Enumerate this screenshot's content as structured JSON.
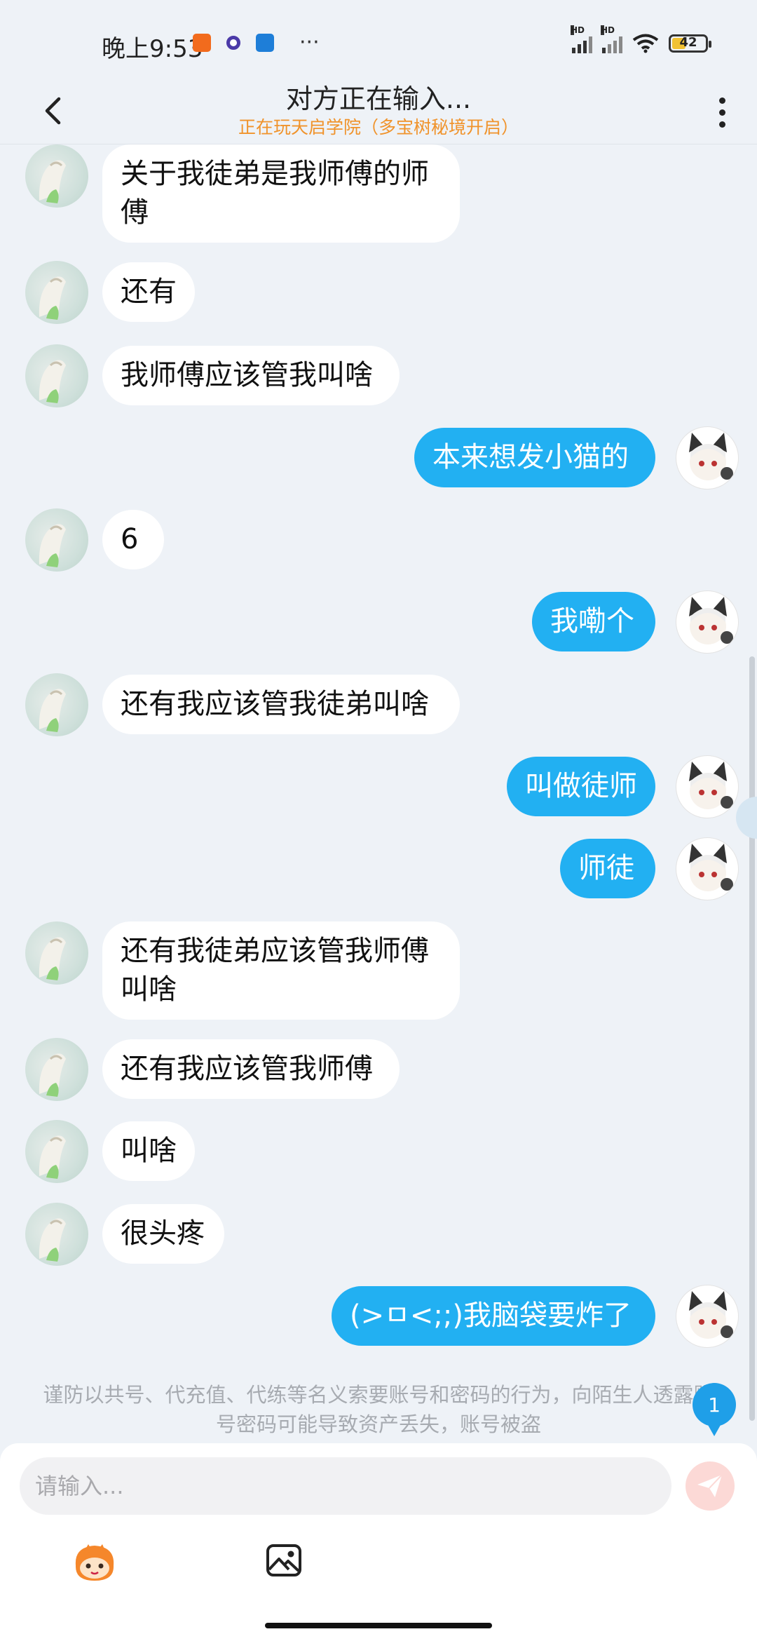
{
  "status_bar": {
    "time": "晚上9:53",
    "signal_label_1": "HD",
    "signal_label_2": "HD",
    "battery": "42",
    "battery_fraction": 0.42,
    "overflow": "···"
  },
  "header": {
    "title": "对方正在输入...",
    "subtitle": "正在玩天启学院（多宝树秘境开启）",
    "back_icon": "chevron-left-icon",
    "more_icon": "more-vertical-icon"
  },
  "colors": {
    "outgoing_bubble": "#22b0f2",
    "incoming_bubble": "#ffffff",
    "subtitle": "#f0932b",
    "badge": "#1f9fe8",
    "background": "#eef2f7"
  },
  "messages": [
    {
      "side": "left",
      "text": "关于我徒弟是我师傅的师\n傅"
    },
    {
      "side": "left",
      "text": "还有"
    },
    {
      "side": "left",
      "text": "我师傅应该管我叫啥"
    },
    {
      "side": "right",
      "text": "本来想发小猫的"
    },
    {
      "side": "left",
      "text": "6"
    },
    {
      "side": "right",
      "text": "我嘞个"
    },
    {
      "side": "left",
      "text": "还有我应该管我徒弟叫啥"
    },
    {
      "side": "right",
      "text": "叫做徒师"
    },
    {
      "side": "right",
      "text": "师徒"
    },
    {
      "side": "left",
      "text": "还有我徒弟应该管我师傅\n叫啥"
    },
    {
      "side": "left",
      "text": "还有我应该管我师傅"
    },
    {
      "side": "left",
      "text": "叫啥"
    },
    {
      "side": "left",
      "text": "很头疼"
    },
    {
      "side": "right",
      "text": "(>ㅁ<;;)我脑袋要炸了"
    }
  ],
  "notice": "谨防以共号、代充值、代练等名义索要账号和密码的行为，向陌生人透露账号密码可能导致资产丢失，账号被盗",
  "unread_badge": "1",
  "composer": {
    "placeholder": "请输入...",
    "send_icon": "send-icon",
    "emoji_icon": "emoji-face-icon",
    "image_icon": "image-icon"
  }
}
